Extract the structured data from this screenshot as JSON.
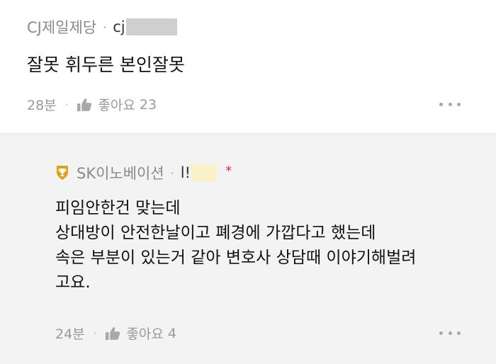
{
  "comment": {
    "author": "CJ제일제당",
    "separator": "·",
    "user_id": "cj",
    "text": "잘못 휘두른 본인잘못",
    "time": "28분",
    "meta_separator": "·",
    "like_label": "좋아요",
    "like_count": "23",
    "more_icon": "more-dots-icon"
  },
  "reply": {
    "badge_icon": "trophy-icon",
    "author": "SK이노베이션",
    "separator": "·",
    "user_id": "l!",
    "star": "*",
    "lines": [
      "피임안한건 맞는데",
      "상대방이 안전한날이고 폐경에 가깝다고 했는데",
      "속은 부분이 있는거 같아 변호사 상담때 이야기해벌려",
      "고요."
    ],
    "time": "24분",
    "meta_separator": "·",
    "like_label": "좋아요",
    "like_count": "4",
    "more_icon": "more-dots-icon"
  },
  "colors": {
    "meta_gray": "#9a9a9a",
    "reply_bg": "#f3f3f3",
    "badge_gold": "#d9a21b",
    "star_red": "#e0284f"
  }
}
